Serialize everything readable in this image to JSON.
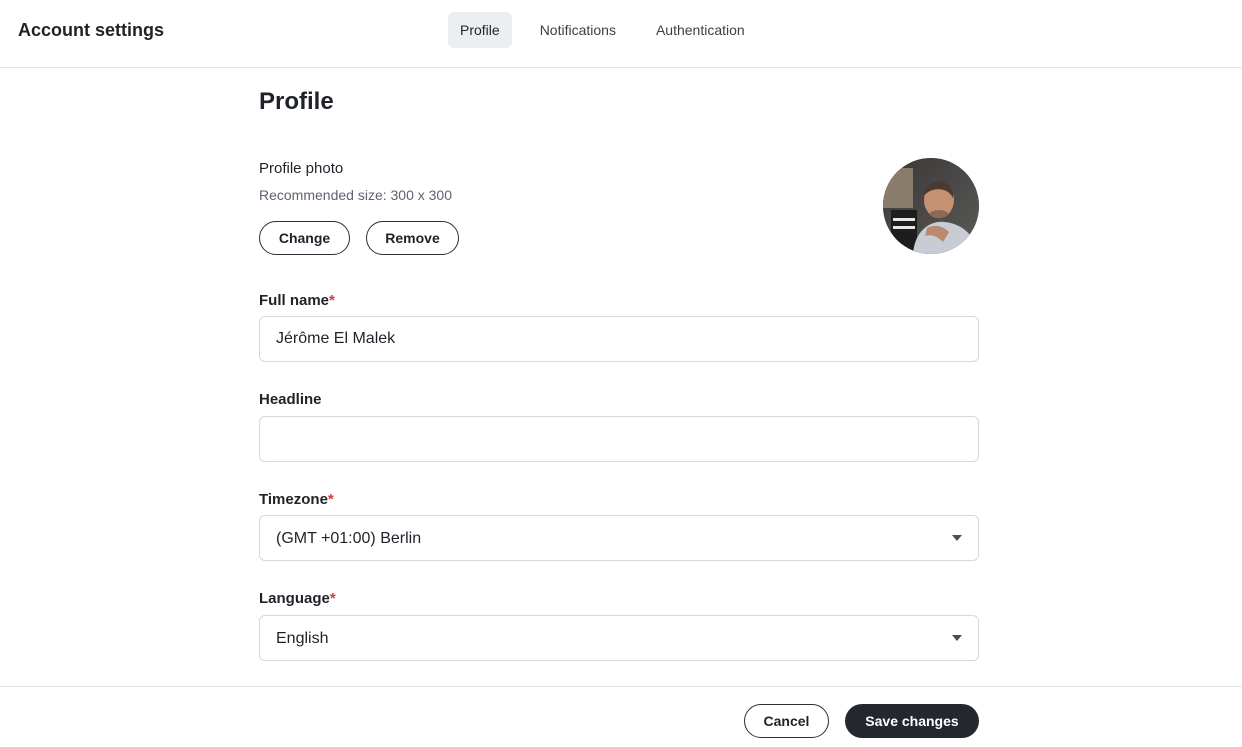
{
  "header": {
    "title": "Account settings",
    "tabs": [
      {
        "label": "Profile",
        "active": true
      },
      {
        "label": "Notifications",
        "active": false
      },
      {
        "label": "Authentication",
        "active": false
      }
    ]
  },
  "profile": {
    "title": "Profile",
    "photo": {
      "label": "Profile photo",
      "hint": "Recommended size: 300 x 300",
      "change_label": "Change",
      "remove_label": "Remove"
    },
    "full_name": {
      "label": "Full name",
      "required_mark": "*",
      "value": "Jérôme El Malek"
    },
    "headline": {
      "label": "Headline",
      "value": ""
    },
    "timezone": {
      "label": "Timezone",
      "required_mark": "*",
      "value": "(GMT +01:00) Berlin"
    },
    "language": {
      "label": "Language",
      "required_mark": "*",
      "value": "English"
    }
  },
  "footer": {
    "cancel_label": "Cancel",
    "save_label": "Save changes"
  },
  "colors": {
    "accent_dark": "#24272d",
    "required": "#d13b3b",
    "active_tab_bg": "#eceef1"
  },
  "icons": {
    "select_caret": "chevron-down-icon"
  }
}
